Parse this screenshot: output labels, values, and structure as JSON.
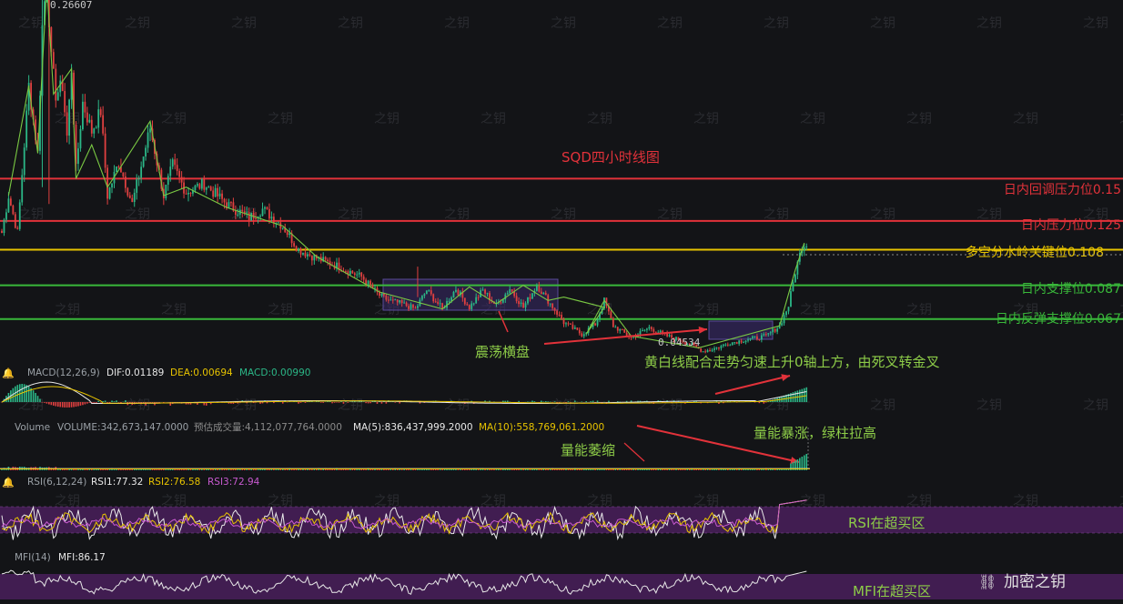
{
  "chart_data": {
    "type": "candlestick",
    "title": "SQD四小时线图",
    "price": {
      "high_label": "0.26607",
      "low_label": "0.04534",
      "levels": [
        {
          "label": "日内回调压力位0.15",
          "value": 0.15,
          "color": "#e2323a"
        },
        {
          "label": "日内压力位0.125",
          "value": 0.125,
          "color": "#e2323a"
        },
        {
          "label": "多空分水岭关键位0.108",
          "value": 0.108,
          "color": "#e7c300"
        },
        {
          "label": "日内支撑位0.087",
          "value": 0.087,
          "color": "#39b83a"
        },
        {
          "label": "日内反弹支撑位0.067",
          "value": 0.067,
          "color": "#39b83a"
        }
      ],
      "anchors": [
        [
          0,
          0.118
        ],
        [
          3,
          0.14
        ],
        [
          7,
          0.118
        ],
        [
          12,
          0.205
        ],
        [
          16,
          0.165
        ],
        [
          18,
          0.24
        ],
        [
          20,
          0.27
        ],
        [
          22,
          0.22
        ],
        [
          24,
          0.2
        ],
        [
          27,
          0.205
        ],
        [
          29,
          0.175
        ],
        [
          31,
          0.215
        ],
        [
          33,
          0.155
        ],
        [
          36,
          0.195
        ],
        [
          40,
          0.178
        ],
        [
          44,
          0.19
        ],
        [
          47,
          0.14
        ],
        [
          52,
          0.16
        ],
        [
          58,
          0.135
        ],
        [
          66,
          0.18
        ],
        [
          72,
          0.14
        ],
        [
          76,
          0.158
        ],
        [
          82,
          0.142
        ],
        [
          90,
          0.147
        ],
        [
          100,
          0.135
        ],
        [
          110,
          0.127
        ],
        [
          116,
          0.132
        ],
        [
          125,
          0.122
        ],
        [
          132,
          0.108
        ],
        [
          140,
          0.103
        ],
        [
          150,
          0.098
        ],
        [
          160,
          0.092
        ],
        [
          168,
          0.081
        ],
        [
          172,
          0.078
        ],
        [
          178,
          0.076
        ],
        [
          184,
          0.073
        ],
        [
          189,
          0.084
        ],
        [
          196,
          0.073
        ],
        [
          202,
          0.085
        ],
        [
          208,
          0.074
        ],
        [
          214,
          0.084
        ],
        [
          220,
          0.075
        ],
        [
          226,
          0.085
        ],
        [
          232,
          0.074
        ],
        [
          238,
          0.087
        ],
        [
          243,
          0.078
        ],
        [
          250,
          0.065
        ],
        [
          258,
          0.058
        ],
        [
          264,
          0.064
        ],
        [
          268,
          0.078
        ],
        [
          272,
          0.063
        ],
        [
          280,
          0.056
        ],
        [
          288,
          0.062
        ],
        [
          296,
          0.057
        ],
        [
          303,
          0.054
        ],
        [
          308,
          0.051
        ],
        [
          312,
          0.048
        ],
        [
          318,
          0.05
        ],
        [
          324,
          0.053
        ],
        [
          332,
          0.055
        ],
        [
          340,
          0.057
        ],
        [
          346,
          0.063
        ],
        [
          350,
          0.075
        ],
        [
          353,
          0.095
        ],
        [
          356,
          0.11
        ],
        [
          358,
          0.112
        ]
      ]
    },
    "annotations": {
      "consolidation": "震荡横盘",
      "macd_note": "黄白线配合走势匀速上升0轴上方，由死叉转金叉",
      "volume_surge": "量能暴涨，绿柱拉高",
      "volume_shrink": "量能萎缩",
      "rsi_note": "RSI在超买区",
      "mfi_note": "MFI在超买区"
    },
    "macd": {
      "title": "MACD(12,26,9)",
      "dif": "DIF:0.01189",
      "dea": "DEA:0.00694",
      "macd": "MACD:0.00990"
    },
    "volume": {
      "title": "Volume",
      "volume": "VOLUME:342,673,147.0000",
      "estimated": "预估成交量:4,112,077,764.0000",
      "ma5": "MA(5):836,437,999.2000",
      "ma10": "MA(10):558,769,061.2000"
    },
    "rsi": {
      "title": "RSI(6,12,24)",
      "rsi1": "RSI1:77.32",
      "rsi2": "RSI2:76.58",
      "rsi3": "RSI3:72.94"
    },
    "mfi": {
      "title": "MFI(14)",
      "value": "MFI:86.17"
    }
  },
  "watermark": {
    "text": "之钥",
    "brand": "加密之钥"
  },
  "colors": {
    "up": "#2bb787",
    "down": "#e04040",
    "bg": "#131417",
    "zone": "#4a1f5c",
    "box": "#5a4a9a"
  }
}
